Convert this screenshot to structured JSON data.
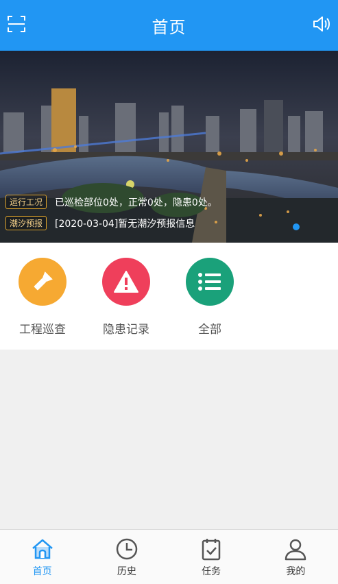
{
  "header": {
    "title": "首页"
  },
  "banner": {
    "notices": [
      {
        "tag": "运行工况",
        "text": "已巡检部位0处，正常0处，隐患0处。"
      },
      {
        "tag": "潮汐预报",
        "text": "[2020-03-04]暂无潮汐预报信息"
      }
    ]
  },
  "quick_actions": [
    {
      "label": "工程巡查",
      "color": "#f6a932",
      "icon": "flashlight-icon"
    },
    {
      "label": "隐患记录",
      "color": "#ef3f5b",
      "icon": "warning-icon"
    },
    {
      "label": "全部",
      "color": "#1aa17a",
      "icon": "list-icon"
    }
  ],
  "tabbar": {
    "items": [
      {
        "label": "首页",
        "icon": "home-icon",
        "active": true
      },
      {
        "label": "历史",
        "icon": "clock-icon"
      },
      {
        "label": "任务",
        "icon": "task-icon"
      },
      {
        "label": "我的",
        "icon": "user-icon"
      }
    ]
  },
  "colors": {
    "primary": "#2196f3",
    "tag_border": "#e0a52a"
  }
}
